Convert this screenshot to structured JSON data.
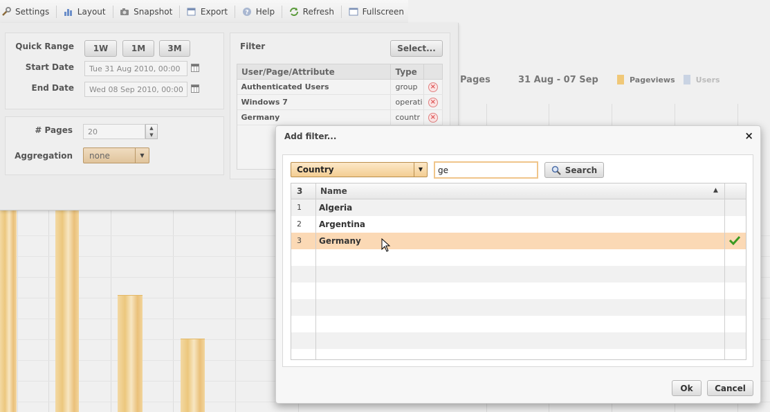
{
  "toolbar": {
    "settings": "Settings",
    "layout": "Layout",
    "snapshot": "Snapshot",
    "export": "Export",
    "help": "Help",
    "refresh": "Refresh",
    "fullscreen": "Fullscreen"
  },
  "config": {
    "quick_range_label": "Quick Range",
    "range_buttons": [
      "1W",
      "1M",
      "3M"
    ],
    "start_date_label": "Start Date",
    "start_date_value": "Tue 31 Aug 2010, 00:00",
    "end_date_label": "End Date",
    "end_date_value": "Wed 08 Sep 2010, 00:00",
    "pages_label": "# Pages",
    "pages_value": "20",
    "aggregation_label": "Aggregation",
    "aggregation_value": "none"
  },
  "filter": {
    "title": "Filter",
    "select_button": "Select...",
    "columns": [
      "User/Page/Attribute",
      "Type"
    ],
    "rows": [
      {
        "name": "Authenticated Users",
        "type": "group"
      },
      {
        "name": "Windows 7",
        "type": "operati"
      },
      {
        "name": "Germany",
        "type": "countr"
      }
    ]
  },
  "chart_header": {
    "title": "Pages",
    "date_range": "31 Aug - 07 Sep",
    "legend": [
      {
        "label": "Pageviews",
        "color": "#f0c878"
      },
      {
        "label": "Users",
        "color": "#c9d3e3"
      }
    ]
  },
  "modal": {
    "title": "Add filter...",
    "close_glyph": "×",
    "type_select": "Country",
    "search_value": "ge",
    "search_button": "Search",
    "result_count": "3",
    "name_column": "Name",
    "sort_glyph": "▲",
    "results": [
      {
        "num": "1",
        "name": "Algeria",
        "selected": false
      },
      {
        "num": "2",
        "name": "Argentina",
        "selected": false
      },
      {
        "num": "3",
        "name": "Germany",
        "selected": true
      }
    ],
    "ok_button": "Ok",
    "cancel_button": "Cancel"
  },
  "colors": {
    "accent": "#f0c878",
    "selected_row": "#fbd9b5",
    "check": "#3a9a22"
  }
}
